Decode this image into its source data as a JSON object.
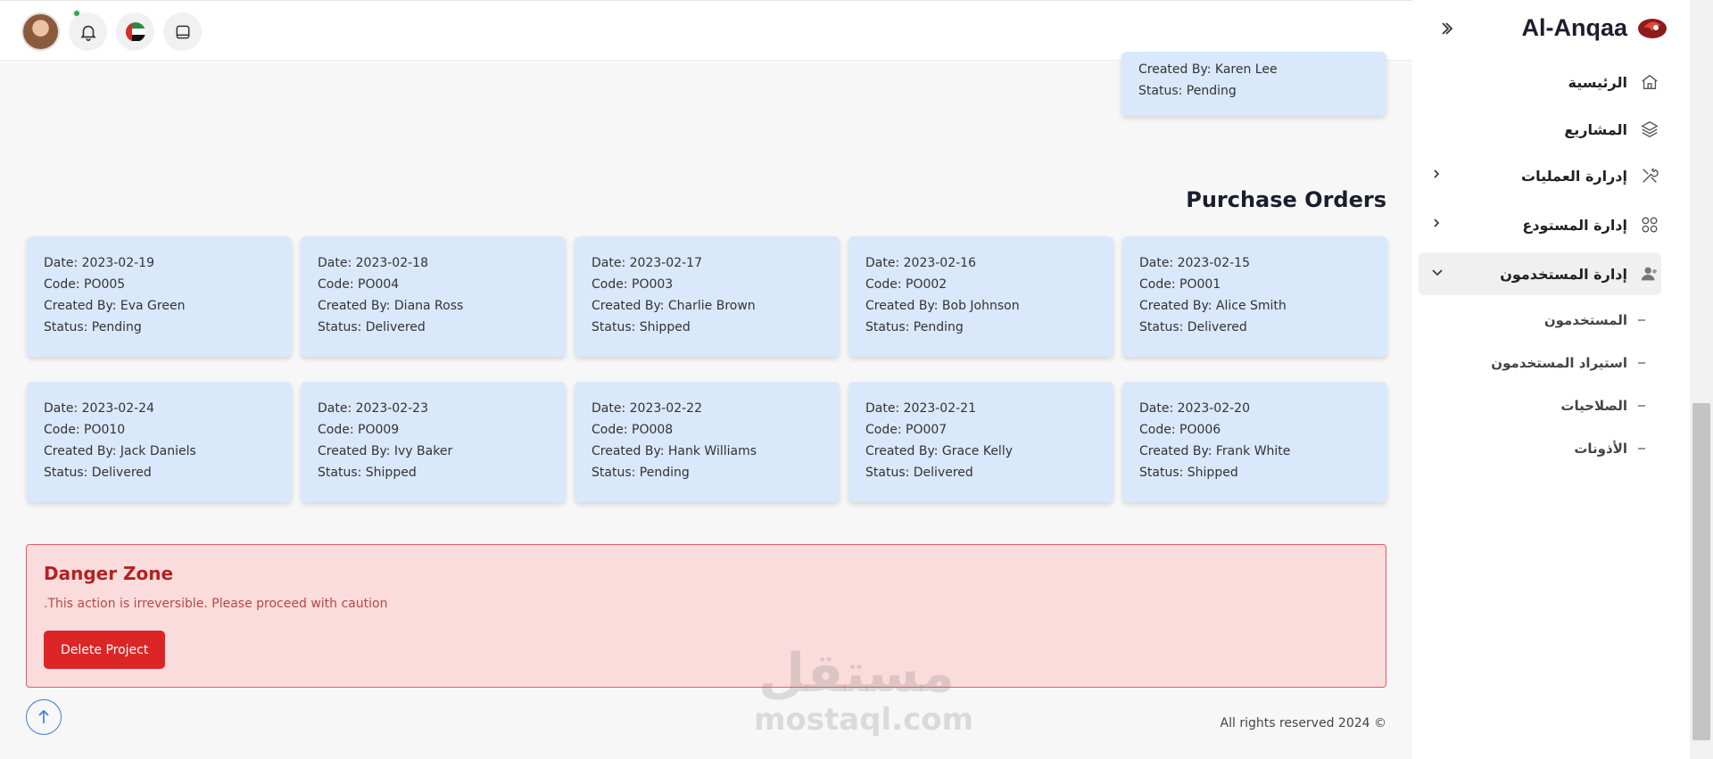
{
  "brand": {
    "name": "Al-Anqaa"
  },
  "sidebar": {
    "items": [
      {
        "label": "الرئيسية",
        "icon": "home-icon"
      },
      {
        "label": "المشاريع",
        "icon": "layers-icon"
      },
      {
        "label": "إدرارة العمليات",
        "icon": "tools-icon",
        "expandable": true
      },
      {
        "label": "إدارة المستودع",
        "icon": "grid-icon",
        "expandable": true
      },
      {
        "label": "إدارة المستخدمون",
        "icon": "users-icon",
        "expanded": true
      }
    ],
    "subitems": [
      "المستخدمون",
      "استيراد المستخدمون",
      "الصلاحيات",
      "الأذونات"
    ]
  },
  "top_card": {
    "created_by": "Created By: Karen Lee",
    "status": "Status: Pending"
  },
  "section": {
    "title": "Purchase Orders"
  },
  "purchase_orders": [
    {
      "date": "Date: 2023-02-19",
      "code": "Code: PO005",
      "created_by": "Created By: Eva Green",
      "status": "Status: Pending"
    },
    {
      "date": "Date: 2023-02-18",
      "code": "Code: PO004",
      "created_by": "Created By: Diana Ross",
      "status": "Status: Delivered"
    },
    {
      "date": "Date: 2023-02-17",
      "code": "Code: PO003",
      "created_by": "Created By: Charlie Brown",
      "status": "Status: Shipped"
    },
    {
      "date": "Date: 2023-02-16",
      "code": "Code: PO002",
      "created_by": "Created By: Bob Johnson",
      "status": "Status: Pending"
    },
    {
      "date": "Date: 2023-02-15",
      "code": "Code: PO001",
      "created_by": "Created By: Alice Smith",
      "status": "Status: Delivered"
    },
    {
      "date": "Date: 2023-02-24",
      "code": "Code: PO010",
      "created_by": "Created By: Jack Daniels",
      "status": "Status: Delivered"
    },
    {
      "date": "Date: 2023-02-23",
      "code": "Code: PO009",
      "created_by": "Created By: Ivy Baker",
      "status": "Status: Shipped"
    },
    {
      "date": "Date: 2023-02-22",
      "code": "Code: PO008",
      "created_by": "Created By: Hank Williams",
      "status": "Status: Pending"
    },
    {
      "date": "Date: 2023-02-21",
      "code": "Code: PO007",
      "created_by": "Created By: Grace Kelly",
      "status": "Status: Delivered"
    },
    {
      "date": "Date: 2023-02-20",
      "code": "Code: PO006",
      "created_by": "Created By: Frank White",
      "status": "Status: Shipped"
    }
  ],
  "danger": {
    "title": "Danger Zone",
    "message": ".This action is irreversible. Please proceed with caution",
    "button": "Delete Project"
  },
  "footer": {
    "text": "All rights reserved 2024 ©"
  },
  "watermark": {
    "ar": "مستقل",
    "en": "mostaql.com"
  },
  "colors": {
    "card_bg": "#dae8fb",
    "danger_bg": "#fbdcdc",
    "danger_button": "#dc2626",
    "accent_blue": "#3a7bd5"
  }
}
